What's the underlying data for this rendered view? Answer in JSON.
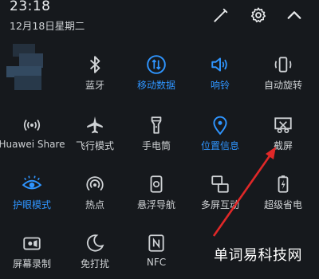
{
  "status": {
    "time": "23:18",
    "date": "12月18日星期二"
  },
  "header_icons": [
    "edit-icon",
    "gear-icon",
    "chevron-up-icon"
  ],
  "tiles": {
    "bluetooth": "蓝牙",
    "mobile_data": "移动数据",
    "ringer": "响铃",
    "auto_rotate": "自动旋转",
    "huawei_share": "Huawei Share",
    "airplane": "飞行模式",
    "flashlight": "手电筒",
    "location": "位置信息",
    "screenshot": "截屏",
    "eye_comfort": "护眼模式",
    "hotspot": "热点",
    "floating_nav": "悬浮导航",
    "multi_screen": "多屏互动",
    "power_saving": "超级省电",
    "screen_record": "屏幕录制",
    "dnd": "免打扰",
    "nfc": "NFC"
  },
  "active_tiles": [
    "mobile_data",
    "ringer",
    "location",
    "eye_comfort"
  ],
  "colors": {
    "background": "#16191d",
    "accent": "#2f95ff",
    "arrow": "#e02828"
  },
  "watermark": "单词易科技网"
}
